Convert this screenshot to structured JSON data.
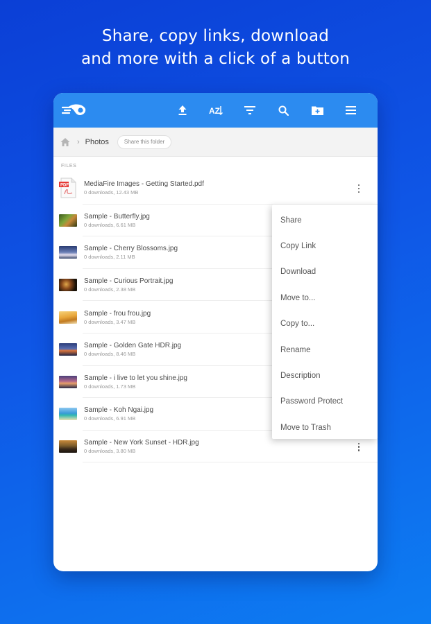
{
  "headline": {
    "line1": "Share, copy links, download",
    "line2": "and more with a click of a button"
  },
  "colors": {
    "topbar": "#2c8bf0",
    "background_start": "#0b3fd6",
    "background_end": "#0d7df2"
  },
  "toolbar": {
    "logo": "mediafire-logo-icon",
    "actions": [
      "upload-icon",
      "sort-az-icon",
      "filter-icon",
      "search-icon",
      "new-folder-icon",
      "menu-icon"
    ],
    "sort_label": "AZ"
  },
  "breadcrumb": {
    "home": "home-icon",
    "folder": "Photos",
    "share_button": "Share this folder"
  },
  "section_label": "FILES",
  "files": [
    {
      "name": "MediaFire Images - Getting Started.pdf",
      "sub": "0 downloads, 12.43 MB",
      "type": "pdf"
    },
    {
      "name": "Sample - Butterfly.jpg",
      "sub": "0 downloads, 6.61 MB",
      "type": "image"
    },
    {
      "name": "Sample - Cherry Blossoms.jpg",
      "sub": "0 downloads, 2.11 MB",
      "type": "image"
    },
    {
      "name": "Sample - Curious Portrait.jpg",
      "sub": "0 downloads, 2.38 MB",
      "type": "image"
    },
    {
      "name": "Sample - frou frou.jpg",
      "sub": "0 downloads, 3.47 MB",
      "type": "image"
    },
    {
      "name": "Sample - Golden Gate HDR.jpg",
      "sub": "0 downloads, 8.46 MB",
      "type": "image"
    },
    {
      "name": "Sample - i live to let you shine.jpg",
      "sub": "0 downloads, 1.73 MB",
      "type": "image"
    },
    {
      "name": "Sample - Koh Ngai.jpg",
      "sub": "0 downloads, 6.91 MB",
      "type": "image"
    },
    {
      "name": "Sample - New York Sunset - HDR.jpg",
      "sub": "0 downloads, 3.80 MB",
      "type": "image"
    }
  ],
  "context_menu": [
    "Share",
    "Copy Link",
    "Download",
    "Move to...",
    "Copy to...",
    "Rename",
    "Description",
    "Password Protect",
    "Move to Trash"
  ]
}
